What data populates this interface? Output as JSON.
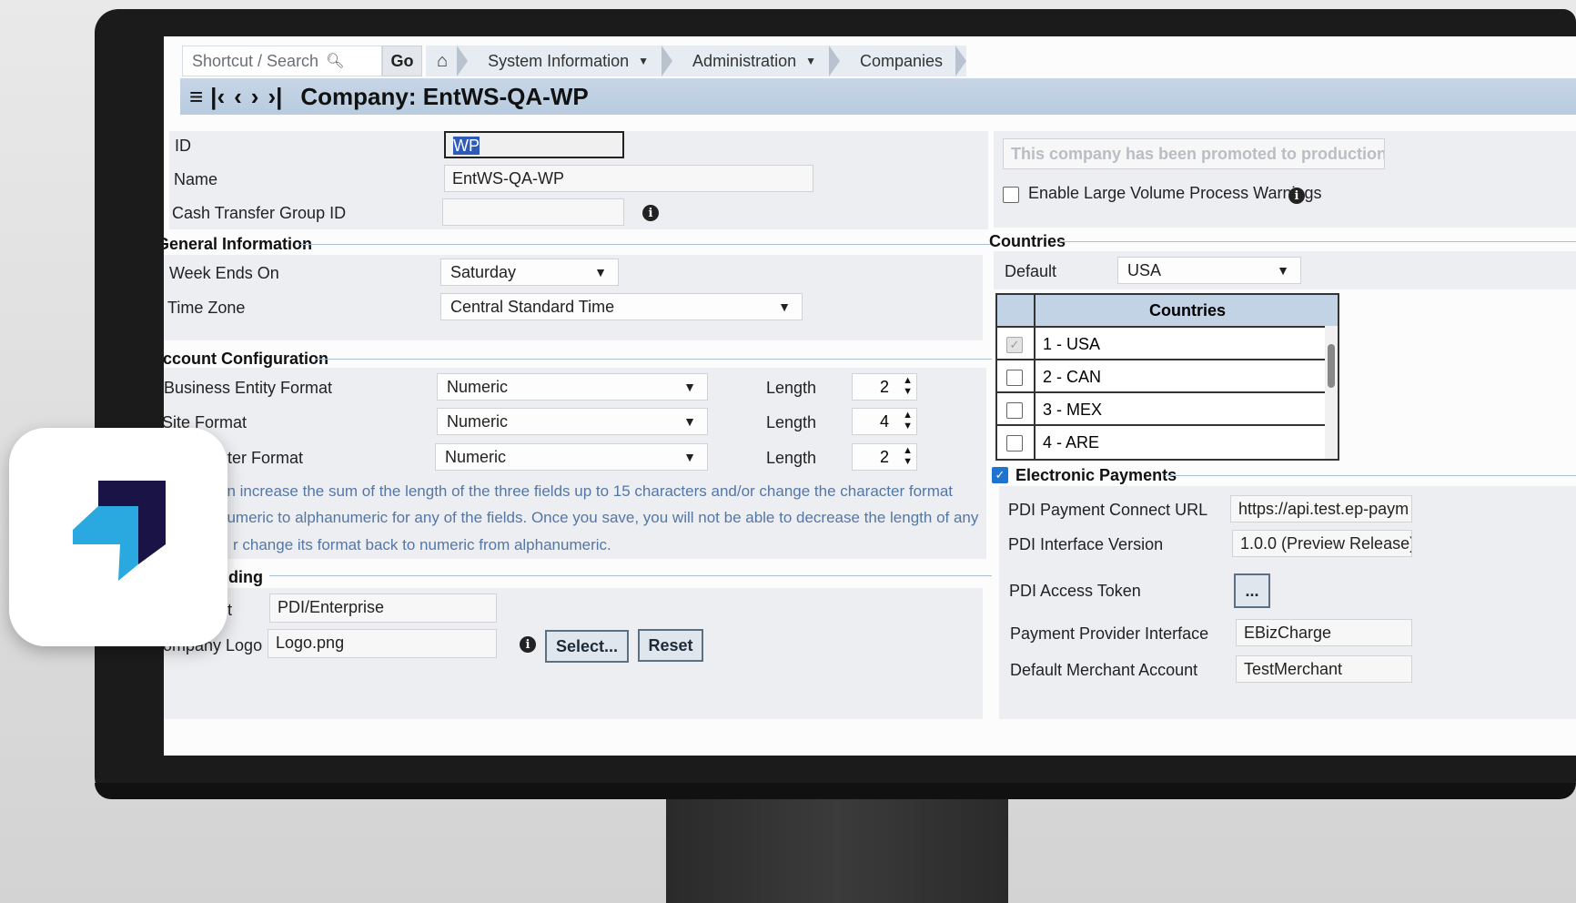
{
  "topbar": {
    "search_placeholder": "Shortcut / Search",
    "go_label": "Go",
    "breadcrumbs": [
      {
        "label": "System Information"
      },
      {
        "label": "Administration"
      },
      {
        "label": "Companies"
      }
    ]
  },
  "title": "Company: EntWS-QA-WP",
  "form": {
    "id_label": "ID",
    "id_value": "WP",
    "name_label": "Name",
    "name_value": "EntWS-QA-WP",
    "cash_label": "Cash Transfer Group ID",
    "cash_value": ""
  },
  "general": {
    "section": "General Information",
    "week_label": "Week Ends On",
    "week_value": "Saturday",
    "tz_label": "Time Zone",
    "tz_value": "Central Standard Time"
  },
  "account": {
    "section": "Account Configuration",
    "rows": [
      {
        "label": "Business Entity Format",
        "format": "Numeric",
        "length_label": "Length",
        "length": "2"
      },
      {
        "label": "Site Format",
        "format": "Numeric",
        "length_label": "Length",
        "length": "4"
      },
      {
        "label": "enter Format",
        "format": "Numeric",
        "length_label": "Length",
        "length": "2"
      }
    ],
    "note_line1": "an increase the sum of the length of the three fields up to 15 characters and/or change the character format",
    "note_line2": "numeric to alphanumeric for any of the fields. Once you save, you will not be able to decrease the length of any",
    "note_line3": "r change its format back to numeric from alphanumeric."
  },
  "branding": {
    "section": "nding",
    "row1_label": "t",
    "row1_value": "PDI/Enterprise",
    "logo_label": "Company Logo",
    "logo_value": "Logo.png",
    "select_label": "Select...",
    "reset_label": "Reset"
  },
  "right": {
    "promoted": "This company has been promoted to production",
    "large_volume": "Enable Large Volume Process Warnings",
    "countries_section": "Countries",
    "default_label": "Default",
    "default_value": "USA",
    "grid_header": "Countries",
    "countries": [
      "1 - USA",
      "2 - CAN",
      "3 - MEX",
      "4 - ARE"
    ],
    "epay_label": "Electronic Payments",
    "epay_rows": [
      {
        "label": "PDI Payment Connect URL",
        "value": "https://api.test.ep-paym"
      },
      {
        "label": "PDI Interface Version",
        "value": "1.0.0 (Preview Release)"
      },
      {
        "label": "PDI Access Token",
        "value": "..."
      },
      {
        "label": "Payment Provider Interface",
        "value": "EBizCharge"
      },
      {
        "label": "Default Merchant Account",
        "value": "TestMerchant"
      }
    ]
  },
  "colors": {
    "accent": "#1f73d1",
    "title_bar": "#c3d3e6",
    "note": "#5477a6",
    "logo_dark": "#1a1446",
    "logo_light": "#2aa8e0"
  },
  "icons": [
    "search-icon",
    "home-icon",
    "list-icon",
    "first-icon",
    "prev-icon",
    "next-icon",
    "last-icon",
    "info-icon",
    "dropdown-caret-icon",
    "app-logo-icon"
  ]
}
